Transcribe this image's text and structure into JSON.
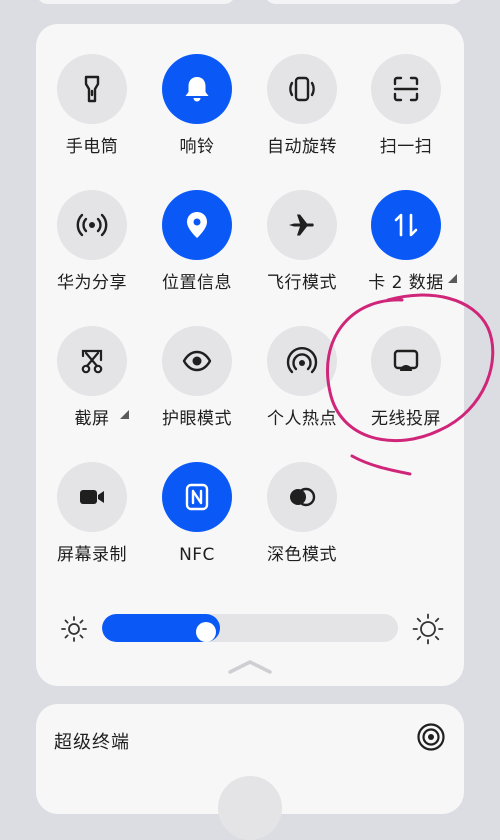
{
  "colors": {
    "accent": "#0a59f7",
    "tile_inactive": "#e4e4e7",
    "panel": "#f7f7f8",
    "annotation": "#d0267a"
  },
  "tiles": [
    {
      "label": "手电筒",
      "icon": "flashlight-icon",
      "active": false
    },
    {
      "label": "响铃",
      "icon": "bell-icon",
      "active": true
    },
    {
      "label": "自动旋转",
      "icon": "auto-rotate-icon",
      "active": false
    },
    {
      "label": "扫一扫",
      "icon": "scan-icon",
      "active": false
    },
    {
      "label": "华为分享",
      "icon": "huawei-share-icon",
      "active": false
    },
    {
      "label": "位置信息",
      "icon": "location-pin-icon",
      "active": true
    },
    {
      "label": "飞行模式",
      "icon": "airplane-icon",
      "active": false
    },
    {
      "label": "卡 2 数据",
      "icon": "mobile-data-icon",
      "active": true
    },
    {
      "label": "截屏",
      "icon": "screenshot-scissors-icon",
      "active": false
    },
    {
      "label": "护眼模式",
      "icon": "eye-icon",
      "active": false
    },
    {
      "label": "个人热点",
      "icon": "hotspot-icon",
      "active": false
    },
    {
      "label": "无线投屏",
      "icon": "wireless-projection-icon",
      "active": false
    },
    {
      "label": "屏幕录制",
      "icon": "screen-record-icon",
      "active": false
    },
    {
      "label": "NFC",
      "icon": "nfc-icon",
      "active": true
    },
    {
      "label": "深色模式",
      "icon": "dark-mode-icon",
      "active": false
    }
  ],
  "brightness": {
    "level": 0.4
  },
  "super_device": {
    "title": "超级终端",
    "icon": "super-device-icon"
  }
}
